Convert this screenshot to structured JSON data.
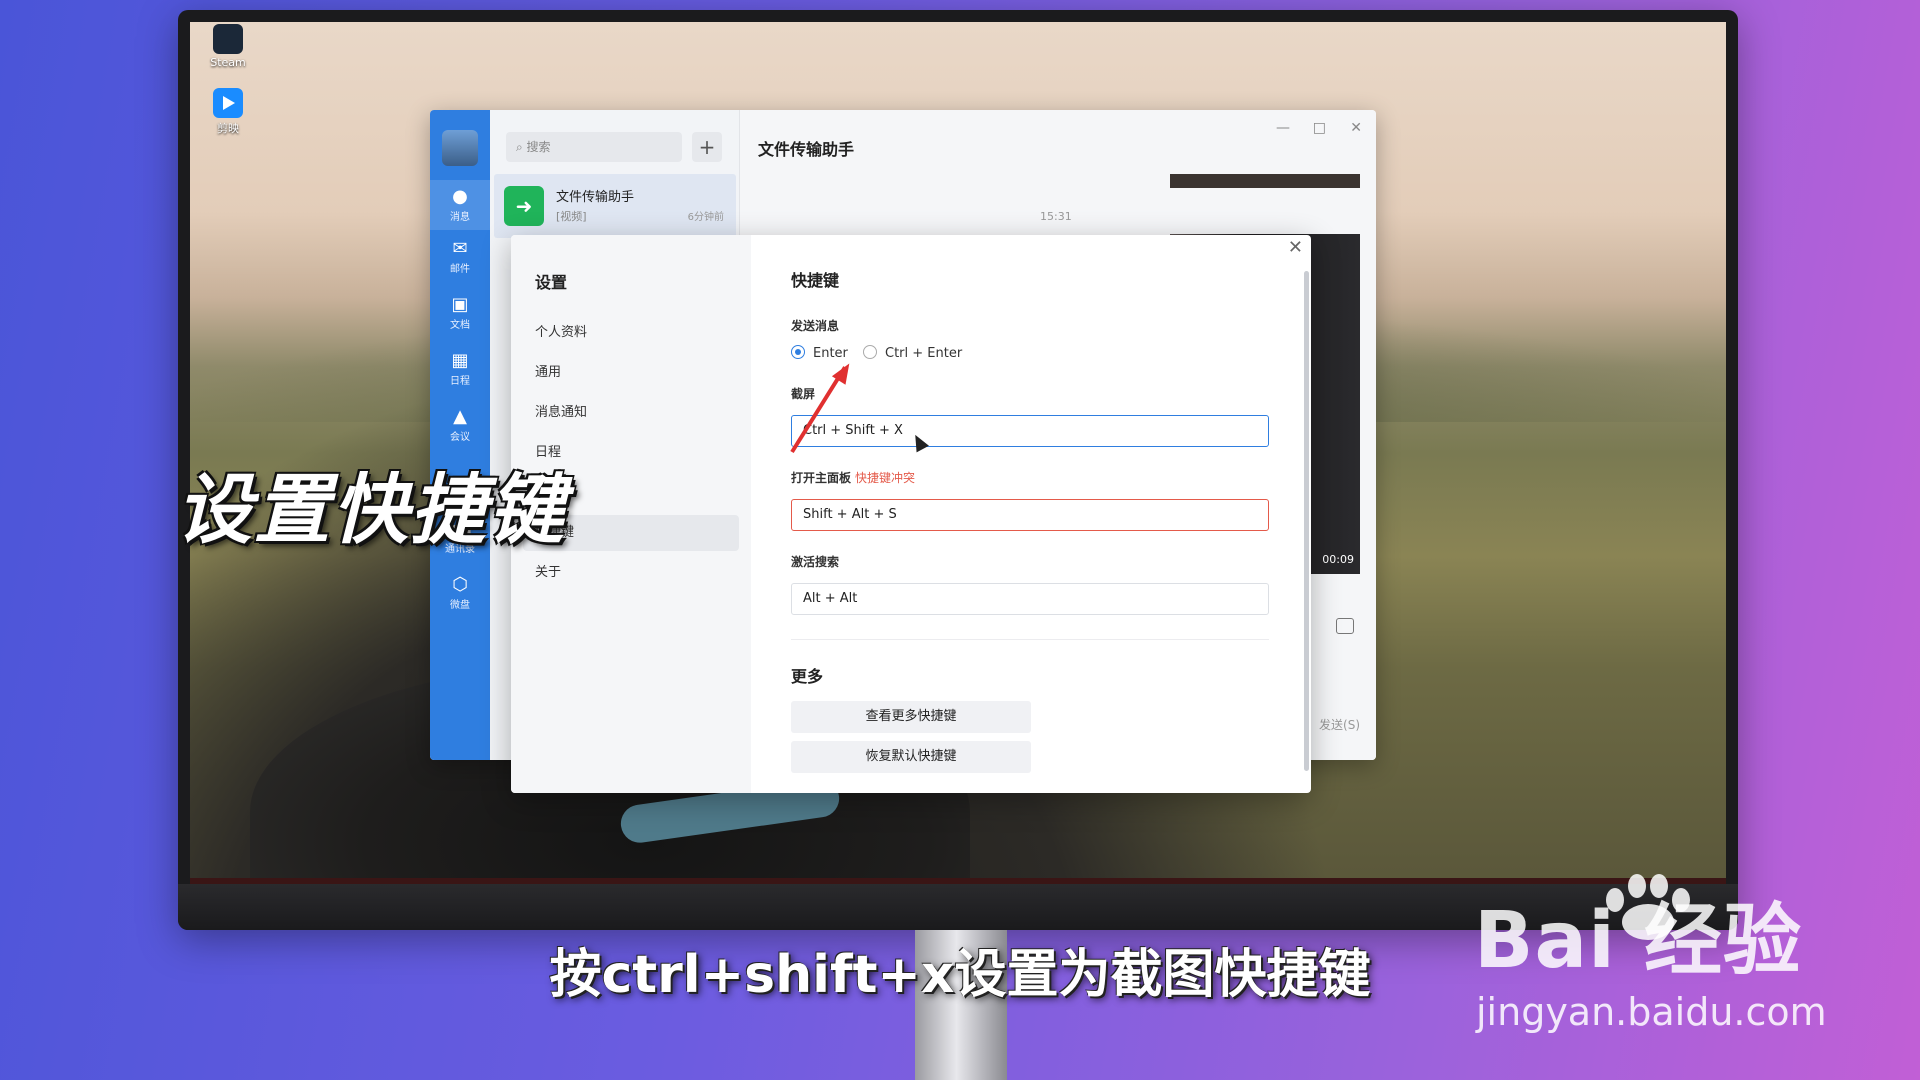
{
  "desktop": {
    "icons": [
      {
        "label": "Steam",
        "icon": "steam-icon"
      },
      {
        "label": "剪映",
        "icon": "jianying-icon"
      }
    ]
  },
  "app": {
    "nav": [
      {
        "label": "消息",
        "icon": "chat-bubble-icon",
        "active": true
      },
      {
        "label": "邮件",
        "icon": "mail-icon"
      },
      {
        "label": "文档",
        "icon": "doc-icon"
      },
      {
        "label": "日程",
        "icon": "calendar-icon"
      },
      {
        "label": "会议",
        "icon": "meeting-icon"
      },
      {
        "label": "通讯录",
        "icon": "contacts-icon"
      },
      {
        "label": "微盘",
        "icon": "cloud-drive-icon"
      }
    ],
    "search_placeholder": "搜索",
    "chat_item": {
      "name": "文件传输助手",
      "preview": "[视频]",
      "time": "6分钟前"
    },
    "chat_title": "文件传输助手",
    "chat_timestamp": "15:31",
    "video_duration": "00:09",
    "send_label": "发送(S)"
  },
  "settings": {
    "title": "设置",
    "menu": [
      "个人资料",
      "通用",
      "消息通知",
      "日程",
      "",
      "快捷键",
      "关于"
    ],
    "active_index": 5,
    "section_title": "快捷键",
    "send_message": {
      "label": "发送消息",
      "options": [
        "Enter",
        "Ctrl + Enter"
      ],
      "selected": 0
    },
    "screenshot": {
      "label": "截屏",
      "value": "Ctrl + Shift + X"
    },
    "open_panel": {
      "label": "打开主面板",
      "warning": "快捷键冲突",
      "value": "Shift + Alt + S"
    },
    "activate_search": {
      "label": "激活搜索",
      "value": "Alt + Alt"
    },
    "more_title": "更多",
    "more_buttons": [
      "查看更多快捷键",
      "恢复默认快捷键"
    ]
  },
  "overlay_title": "设置快捷键",
  "subtitle": "按ctrl+shift+x设置为截图快捷键",
  "watermark": {
    "brand": "Bai  经验",
    "url": "jingyan.baidu.com"
  },
  "colors": {
    "accent": "#2f7ee0",
    "conflict": "#e45a4a",
    "arrow": "#e03030"
  }
}
